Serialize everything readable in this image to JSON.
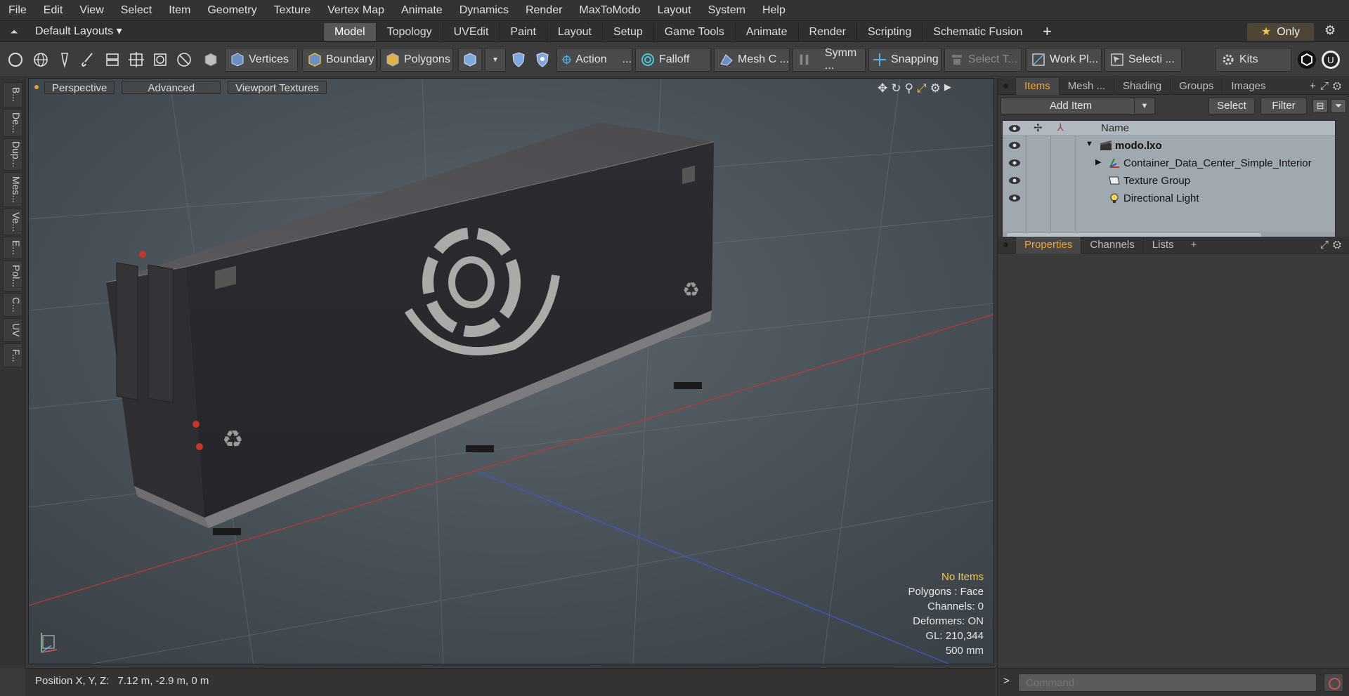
{
  "menu": [
    "File",
    "Edit",
    "View",
    "Select",
    "Item",
    "Geometry",
    "Texture",
    "Vertex Map",
    "Animate",
    "Dynamics",
    "Render",
    "MaxToModo",
    "Layout",
    "System",
    "Help"
  ],
  "layout_bar": {
    "layouts_label": "Default Layouts ▾",
    "tabs": [
      "Model",
      "Topology",
      "UVEdit",
      "Paint",
      "Layout",
      "Setup",
      "Game Tools",
      "Animate",
      "Render",
      "Scripting",
      "Schematic Fusion"
    ],
    "active_tab": "Model",
    "add_tab": "+",
    "only_label": "Only"
  },
  "toolbar": {
    "vertices": "Vertices",
    "boundary": "Boundary",
    "polygons": "Polygons",
    "action": "Action",
    "action_more": "...",
    "falloff": "Falloff",
    "mesh_c": "Mesh C ...",
    "symm": "Symm ...",
    "snapping": "Snapping",
    "select_t": "Select T...",
    "work_pl": "Work Pl...",
    "selecti": "Selecti ...",
    "kits": "Kits"
  },
  "left_tabs": [
    "B...",
    "De...",
    "Dup...",
    "Mes...",
    "Ve...",
    "E...",
    "Pol...",
    "C...",
    "UV",
    "F..."
  ],
  "viewport": {
    "header_buttons": [
      "Perspective",
      "Advanced",
      "Viewport Textures"
    ],
    "stats": {
      "no_items": "No Items",
      "polygons": "Polygons : Face",
      "channels": "Channels: 0",
      "deformers": "Deformers: ON",
      "gl": "GL: 210,344",
      "scale": "500 mm"
    }
  },
  "status": {
    "label": "Position X, Y, Z:",
    "value": "7.12 m, -2.9 m, 0 m"
  },
  "items_panel": {
    "tabs": [
      "Items",
      "Mesh ...",
      "Shading",
      "Groups",
      "Images"
    ],
    "active_tab": "Items",
    "add_item": "Add Item",
    "select": "Select",
    "filter": "Filter",
    "column_name": "Name",
    "rows": [
      {
        "label": "modo.lxo",
        "bold": true
      },
      {
        "label": "Container_Data_Center_Simple_Interior"
      },
      {
        "label": "Texture Group"
      },
      {
        "label": "Directional Light"
      }
    ]
  },
  "properties_panel": {
    "tabs": [
      "Properties",
      "Channels",
      "Lists"
    ],
    "active_tab": "Properties",
    "add": "+"
  },
  "command": {
    "placeholder": "Command",
    "arrow": ">"
  },
  "colors": {
    "accent": "#f0a33c",
    "no_items": "#f2c94c",
    "grid_x": "#c0392b",
    "grid_z": "#3a5bd0"
  }
}
